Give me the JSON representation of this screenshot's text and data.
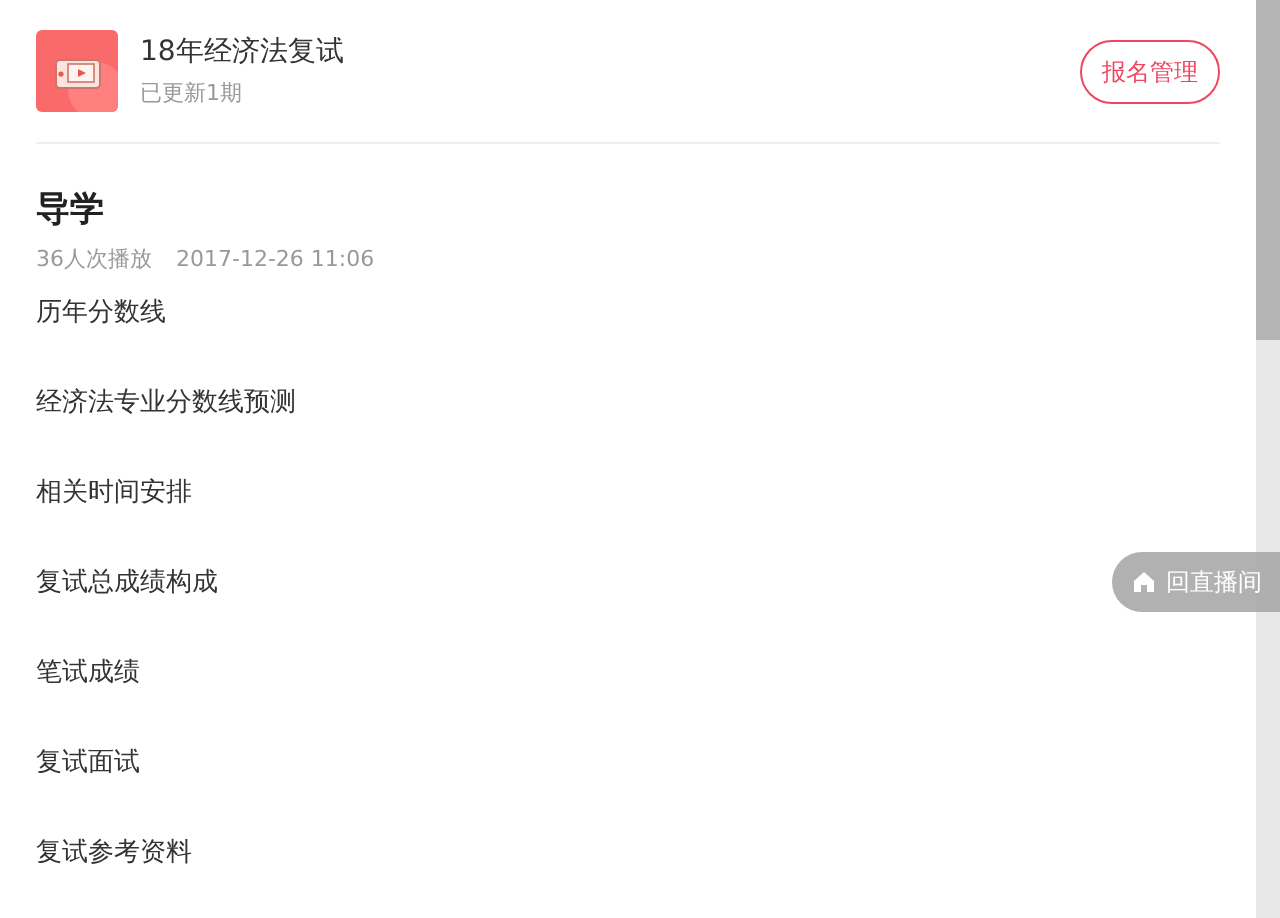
{
  "course": {
    "title": "18年经济法复试",
    "subtitle": "已更新1期",
    "button": "报名管理"
  },
  "lesson": {
    "title": "导学",
    "plays": "36人次播放",
    "date": "2017-12-26 11:06"
  },
  "outline": [
    "历年分数线",
    "经济法专业分数线预测",
    "相关时间安排",
    "复试总成绩构成",
    "笔试成绩",
    "复试面试",
    "复试参考资料"
  ],
  "float_button": {
    "label": "回直播间"
  }
}
